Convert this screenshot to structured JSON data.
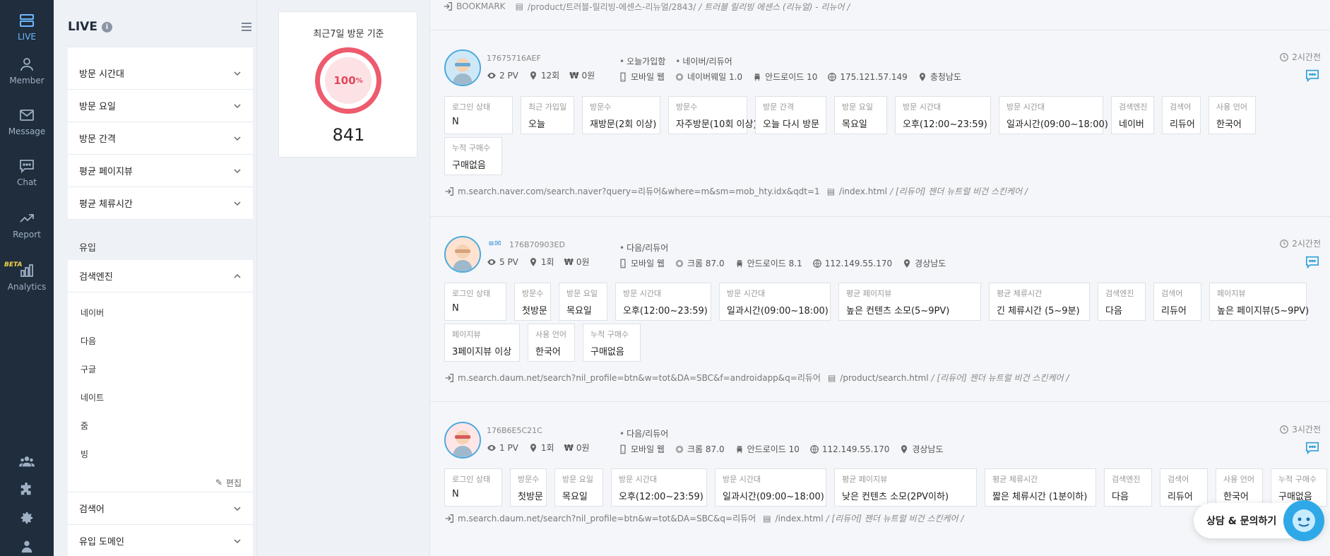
{
  "nav": {
    "items": [
      {
        "label": "LIVE",
        "icon": "live-icon"
      },
      {
        "label": "Member",
        "icon": "member-icon"
      },
      {
        "label": "Message",
        "icon": "message-icon"
      },
      {
        "label": "Chat",
        "icon": "chat-icon"
      },
      {
        "label": "Report",
        "icon": "report-icon"
      },
      {
        "label": "Analytics",
        "icon": "analytics-icon",
        "badge": "BETA"
      }
    ],
    "bottom_icons": [
      "users-icon",
      "puzzle-icon",
      "gear-icon",
      "user-icon"
    ]
  },
  "panel": {
    "title": "LIVE",
    "info": "i",
    "filters_top": [
      "방문 시간대",
      "방문 요일",
      "방문 간격",
      "평균 페이지뷰",
      "평균 체류시간"
    ],
    "section_inflow": "유입",
    "search_engine": {
      "label": "검색엔진",
      "items": [
        "네이버",
        "다음",
        "구글",
        "네이트",
        "줌",
        "빙"
      ],
      "edit": "편집"
    },
    "filters_bottom": [
      "검색어",
      "유입 도메인"
    ]
  },
  "stat": {
    "label": "최근7일 방문 기준",
    "percent": "100",
    "percent_unit": "%",
    "value": "841"
  },
  "feed": {
    "top": {
      "bookmark": "BOOKMARK",
      "path": "/product/트러블-릴리빙-에센스-리뉴얼/2843/",
      "title": "/ 트러블 릴리빙 에센스 (리뉴얼) - 리뉴어 /"
    },
    "visitors": [
      {
        "id": "17675716AEF",
        "pv": "2 PV",
        "visits": "12회",
        "amount": "0원",
        "tags": [
          "오늘가입함",
          "네이버/리듀어"
        ],
        "device": [
          "모바일 웹",
          "네이버웨일 1.0",
          "안드로이드 10",
          "175.121.57.149",
          "충청남도"
        ],
        "time": "2시간전",
        "chips": [
          {
            "k": "로그인 상태",
            "v": "N"
          },
          {
            "k": "최근 가입일",
            "v": "오늘"
          },
          {
            "k": "방문수",
            "v": "재방문(2회 이상)"
          },
          {
            "k": "방문수",
            "v": "자주방문(10회 이상)"
          },
          {
            "k": "방문 간격",
            "v": "오늘 다시 방문"
          },
          {
            "k": "방문 요일",
            "v": "목요일"
          },
          {
            "k": "방문 시간대",
            "v": "오후(12:00~23:59)"
          },
          {
            "k": "방문 시간대",
            "v": "일과시간(09:00~18:00)"
          },
          {
            "k": "검색엔진",
            "v": "네이버"
          },
          {
            "k": "검색어",
            "v": "리듀어"
          },
          {
            "k": "사용 언어",
            "v": "한국어"
          },
          {
            "k": "누적 구매수",
            "v": "구매없음"
          }
        ],
        "ref": "m.search.naver.com/search.naver?query=리듀어&where=m&sm=mob_hty.idx&qdt=1",
        "landing": "/index.html",
        "landing_title": "/ [리듀어] 젠더 뉴트럴 비건 스킨케어 /"
      },
      {
        "id": "176B70903ED",
        "pv": "5 PV",
        "visits": "1회",
        "amount": "0원",
        "tags": [
          "다음/리듀어"
        ],
        "device": [
          "모바일 웹",
          "크롬 87.0",
          "안드로이드 8.1",
          "112.149.55.170",
          "경상남도"
        ],
        "time": "2시간전",
        "chips": [
          {
            "k": "로그인 상태",
            "v": "N"
          },
          {
            "k": "방문수",
            "v": "첫방문"
          },
          {
            "k": "방문 요일",
            "v": "목요일"
          },
          {
            "k": "방문 시간대",
            "v": "오후(12:00~23:59)"
          },
          {
            "k": "방문 시간대",
            "v": "일과시간(09:00~18:00)"
          },
          {
            "k": "평균 페이지뷰",
            "v": "높은 컨텐츠 소모(5~9PV)"
          },
          {
            "k": "평균 체류시간",
            "v": "긴 체류시간 (5~9분)"
          },
          {
            "k": "검색엔진",
            "v": "다음"
          },
          {
            "k": "검색어",
            "v": "리듀어"
          },
          {
            "k": "페이지뷰",
            "v": "높은 페이지뷰(5~9PV)"
          },
          {
            "k": "페이지뷰",
            "v": "3페이지뷰 이상"
          },
          {
            "k": "사용 언어",
            "v": "한국어"
          },
          {
            "k": "누적 구매수",
            "v": "구매없음"
          }
        ],
        "ref": "m.search.daum.net/search?nil_profile=btn&w=tot&DA=SBC&f=androidapp&q=리듀어",
        "landing": "/product/search.html",
        "landing_title": "/ [리듀어] 젠더 뉴트럴 비건 스킨케어 /"
      },
      {
        "id": "176B6E5C21C",
        "pv": "1 PV",
        "visits": "1회",
        "amount": "0원",
        "tags": [
          "다음/리듀어"
        ],
        "device": [
          "모바일 웹",
          "크롬 87.0",
          "안드로이드 10",
          "112.149.55.170",
          "경상남도"
        ],
        "time": "3시간전",
        "chips": [
          {
            "k": "로그인 상태",
            "v": "N"
          },
          {
            "k": "방문수",
            "v": "첫방문"
          },
          {
            "k": "방문 요일",
            "v": "목요일"
          },
          {
            "k": "방문 시간대",
            "v": "오후(12:00~23:59)"
          },
          {
            "k": "방문 시간대",
            "v": "일과시간(09:00~18:00)"
          },
          {
            "k": "평균 페이지뷰",
            "v": "낮은 컨텐츠 소모(2PV이하)"
          },
          {
            "k": "평균 체류시간",
            "v": "짧은 체류시간 (1분이하)"
          },
          {
            "k": "검색엔진",
            "v": "다음"
          },
          {
            "k": "검색어",
            "v": "리듀어"
          },
          {
            "k": "사용 언어",
            "v": "한국어"
          },
          {
            "k": "누적 구매수",
            "v": "구매없음"
          }
        ],
        "ref": "m.search.daum.net/search?nil_profile=btn&w=tot&DA=SBC&q=리듀어",
        "landing": "/index.html",
        "landing_title": "/ [리듀어] 젠더 뉴트럴 비건 스킨케어 /"
      }
    ]
  },
  "chat_widget": {
    "label": "상담 & 문의하기"
  },
  "colors": {
    "nav_bg": "#1f2d3d",
    "accent": "#2fa0d8",
    "ring": "#ee5a6e"
  }
}
